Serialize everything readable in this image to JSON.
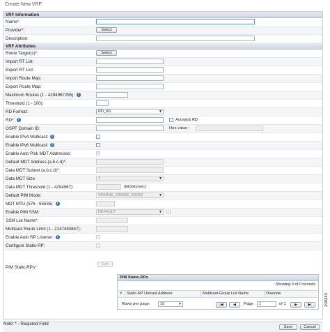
{
  "window_title": "Create New VRF",
  "sections": {
    "vrf_information": "VRF Information",
    "vrf_attributes": "VRF Attributes"
  },
  "fields": {
    "name": "Name",
    "provider": "Provider",
    "description": "Description:",
    "route_targets": "Route Target(s)",
    "import_rt_list": "Import RT List:",
    "export_rt_list": "Export RT List:",
    "import_route_map": "Import Route Map:",
    "export_route_map": "Export Route Map:",
    "maximum_routes": "Maximum Routes (1 - 4294967295):",
    "threshold": "Threshold (1 - 100):",
    "rd_format": "RD Format:",
    "rd": "RD",
    "autopick_rd": "Autopick RD",
    "ospf_domain_id": "OSPF Domain ID:",
    "hex_value": "Hex value :",
    "enable_ipv4_multicast": "Enable IPv4 Multicast:",
    "enable_ipv6_multicast": "Enable IPv6 Multicast:",
    "enable_auto_pick_mdt": "Enable Auto Pick MDT Addresses:",
    "default_mdt_address": "Default MDT Address (a.b.c.d)",
    "data_mdt_subnet": "Data MDT Subnet (a.b.c.d)",
    "data_mdt_size": "Data MDT Size:",
    "data_mdt_threshold": "Data MDT Threshold (1 - 4294967):",
    "kilobits": "(kilobits/sec)",
    "default_pim_mode": "Default PIM Mode:",
    "mdt_mtu": "MDT MTU (576 - 65535):",
    "enable_pim_ssm": "Enable PIM SSM:",
    "ssm_list_name": "SSM List Name",
    "multicast_route_limit": "Multicast Route Limit (1 - 2147483647):",
    "enable_auto_rp_listener": "Enable Auto RP Listener:",
    "configure_static_rp": "Configure Static-RP:",
    "pim_static_rps": "PIM Static-RPs"
  },
  "buttons": {
    "select": "Select",
    "edit": "Edit",
    "save": "Save",
    "cancel": "Cancel"
  },
  "values": {
    "rd_format": "RD_AS",
    "data_mdt_size": "1",
    "default_pim_mode": "SPARSE_DENSE_MODE",
    "enable_pim_ssm": "DEFAULT"
  },
  "pim_table": {
    "title": "PIM Static-RPs",
    "count": "Showing 0 of 0 records",
    "columns": [
      "#",
      "Static-RP Unicast Address",
      "Multicast-Group List Name",
      "Override"
    ],
    "rows_per_page_label": "Rows per page:",
    "rows_per_page": "10",
    "page_label": "Page",
    "page": "1",
    "of_label": "of 1"
  },
  "note": "Note: * - Required Field",
  "figure_number": "209343"
}
